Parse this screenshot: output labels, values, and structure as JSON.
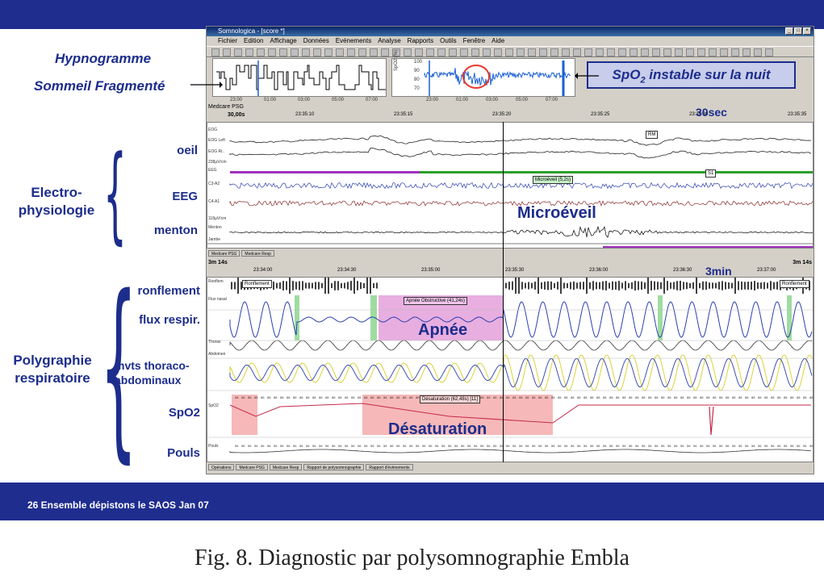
{
  "window": {
    "title": "Somnologica - [score *]",
    "menu": [
      "Fichier",
      "Edition",
      "Affichage",
      "Données",
      "Evénements",
      "Analyse",
      "Rapports",
      "Outils",
      "Fenêtre",
      "Aide"
    ]
  },
  "annotations": {
    "hypnogram": "Hypnogramme",
    "fragmented": "Sommeil Fragmenté",
    "spo2_callout": "SpO2 instable sur la nuit",
    "eye": "oeil",
    "eeg": "EEG",
    "chin": "menton",
    "electro": "Electro-\nphysiologie",
    "snoring": "ronflement",
    "resp_flow": "flux respir.",
    "thoraco": "mvts thoraco-\nabdominaux",
    "spo2": "SpO2",
    "pulse": "Pouls",
    "poly": "Polygraphie\nrespiratoire",
    "microeveil": "Microéveil",
    "apnea": "Apnée",
    "desat": "Désaturation",
    "sec30": "30sec",
    "min3": "3min"
  },
  "hypnogram": {
    "ticks": [
      "23:00",
      "01:00",
      "03:00",
      "05:00",
      "07:00"
    ]
  },
  "spo2_overview": {
    "ticks": [
      "23:00",
      "01:00",
      "03:00",
      "05:00",
      "07:00"
    ],
    "yticks": [
      "100",
      "90",
      "80",
      "70"
    ],
    "yaxis": "SpO2 (%)"
  },
  "pane1": {
    "header": "Medcare PSG",
    "epoch": "30,00s",
    "times": [
      "23:35:10",
      "23:35:15",
      "23:35:20",
      "23:35:25",
      "23:35:30",
      "23:35:35"
    ],
    "channels": [
      "EOG",
      "EOG Left",
      "EOG Ri..",
      "238µV/cm",
      "EEG",
      "C3-A2",
      "C4-A1",
      "118µV/cm",
      "Menton",
      "Jambe"
    ],
    "tags": {
      "rm": "RM",
      "microeveil": "Microéveil (5,2s)",
      "s1": "S1"
    },
    "tabs": [
      "Medcare PSG",
      "Medcare Resp"
    ]
  },
  "pane2": {
    "duration_left": "3m 14s",
    "duration_right": "3m 14s",
    "times": [
      "23:34:00",
      "23:34:30",
      "23:35:00",
      "23:35:30",
      "23:36:00",
      "23:36:30",
      "23:37:00"
    ],
    "channels": [
      "Ronflem",
      "Flux nasal",
      "Thorax",
      "Abdomen",
      "SpO2",
      "Pouls"
    ],
    "tags": {
      "ronf1": "Ronflement",
      "ronf2": "Ronflement",
      "apnea": "Apnée Obstructive (41,24s)",
      "desat": "Désaturation (62,48s) [11]"
    },
    "tabs": [
      "Opérations",
      "Medcare PSG",
      "Medcare Resp",
      "Rapport de polysomnographie",
      "Rapport d'évènements"
    ]
  },
  "footer": "26 Ensemble dépistons le SAOS Jan 07",
  "caption": "Fig. 8. Diagnostic par polysomnographie Embla",
  "colors": {
    "brand": "#1f2d8f",
    "annot": "#1c2d8c",
    "apnea_band": "#e8aee0",
    "desat_band": "#f6b8b8",
    "green_marker": "#9fdca0"
  }
}
